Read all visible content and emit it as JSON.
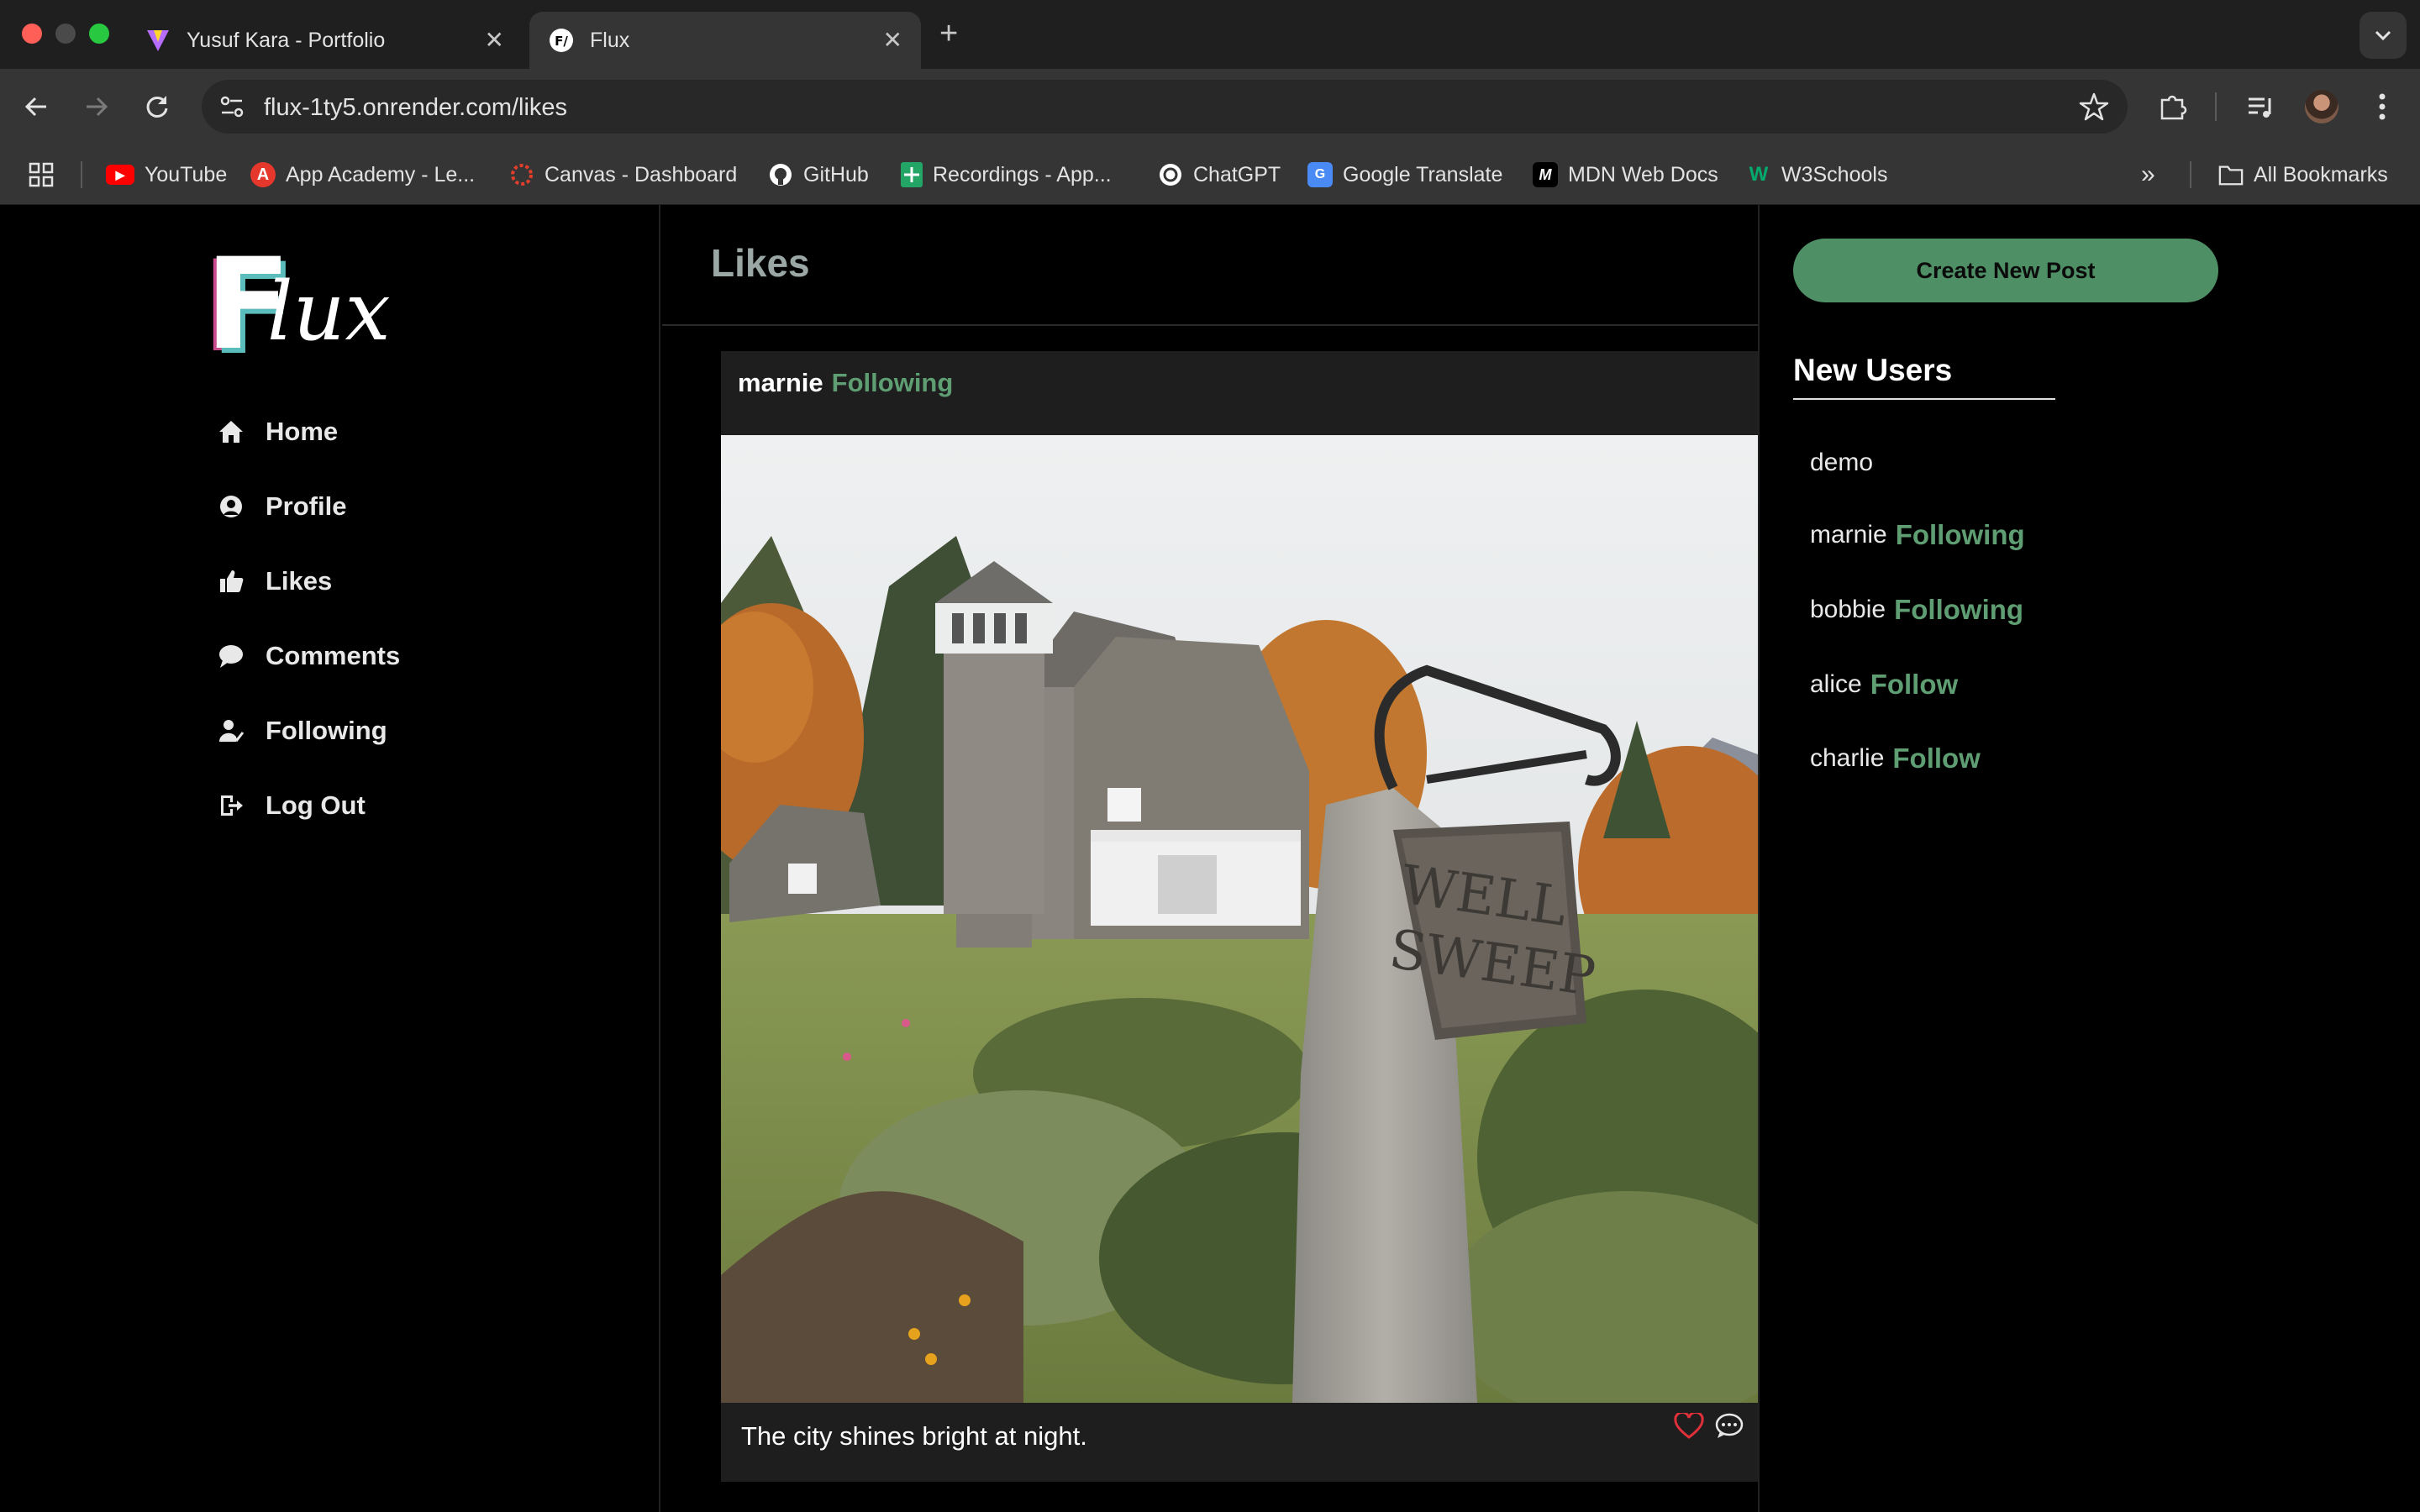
{
  "browser": {
    "tabs": [
      {
        "title": "Yusuf Kara - Portfolio",
        "favicon": "vite-logo-icon",
        "active": false
      },
      {
        "title": "Flux",
        "favicon": "flux-favicon-icon",
        "active": true
      }
    ],
    "url": "flux-1ty5.onrender.com/likes",
    "bookmarks": [
      {
        "label": "YouTube",
        "icon": "youtube-icon",
        "color": "#ff0000"
      },
      {
        "label": "App Academy - Le...",
        "icon": "app-academy-icon",
        "color": "#e5372b"
      },
      {
        "label": "Canvas - Dashboard",
        "icon": "canvas-icon",
        "color": "#e13f2b"
      },
      {
        "label": "GitHub",
        "icon": "github-icon",
        "color": "#ffffff"
      },
      {
        "label": "Recordings - App...",
        "icon": "sheets-icon",
        "color": "#23a566"
      },
      {
        "label": "ChatGPT",
        "icon": "chatgpt-icon",
        "color": "#ffffff"
      },
      {
        "label": "Google Translate",
        "icon": "translate-icon",
        "color": "#4a8af4"
      },
      {
        "label": "MDN Web Docs",
        "icon": "mdn-icon",
        "color": "#000000"
      },
      {
        "label": "W3Schools",
        "icon": "w3schools-icon",
        "color": "#04aa6d"
      }
    ],
    "all_bookmarks": "All Bookmarks"
  },
  "app": {
    "logo_first": "F",
    "logo_rest": "lux",
    "nav": [
      {
        "label": "Home",
        "icon": "home-icon"
      },
      {
        "label": "Profile",
        "icon": "profile-icon"
      },
      {
        "label": "Likes",
        "icon": "thumbs-up-icon"
      },
      {
        "label": "Comments",
        "icon": "comment-icon"
      },
      {
        "label": "Following",
        "icon": "user-check-icon"
      },
      {
        "label": "Log Out",
        "icon": "logout-icon"
      }
    ],
    "page_title": "Likes",
    "post": {
      "username": "marnie",
      "follow_status": "Following",
      "caption": "The city shines bright at night.",
      "liked": true
    },
    "create_post_label": "Create New Post",
    "new_users_title": "New Users",
    "new_users": [
      {
        "name": "demo",
        "status": ""
      },
      {
        "name": "marnie",
        "status": "Following"
      },
      {
        "name": "bobbie",
        "status": "Following"
      },
      {
        "name": "alice",
        "status": "Follow"
      },
      {
        "name": "charlie",
        "status": "Follow"
      }
    ]
  },
  "colors": {
    "accent_green": "#5e9e72",
    "button_green": "#4e8f65",
    "like_red": "#e0303a"
  }
}
